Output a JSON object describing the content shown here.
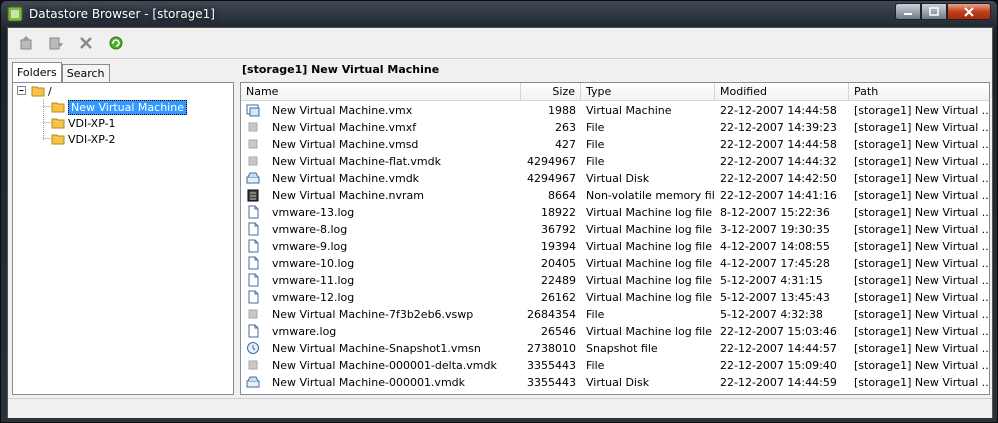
{
  "window": {
    "title": "Datastore Browser - [storage1]"
  },
  "toolbar": {
    "buttons": [
      {
        "icon": "upload-icon"
      },
      {
        "icon": "download-icon"
      },
      {
        "icon": "delete-icon"
      },
      {
        "icon": "refresh-icon"
      }
    ]
  },
  "left": {
    "tabs": [
      {
        "label": "Folders"
      },
      {
        "label": "Search"
      }
    ],
    "tree": {
      "root": "/",
      "children": [
        {
          "label": "New Virtual Machine",
          "selected": true
        },
        {
          "label": "VDI-XP-1",
          "selected": false
        },
        {
          "label": "VDI-XP-2",
          "selected": false
        }
      ]
    }
  },
  "right": {
    "title": "[storage1] New Virtual Machine",
    "columns": [
      {
        "label": "Name"
      },
      {
        "label": "Size"
      },
      {
        "label": "Type"
      },
      {
        "label": "Modified"
      },
      {
        "label": "Path"
      }
    ],
    "rows": [
      {
        "icon": "vm-icon",
        "name": "New Virtual Machine.vmx",
        "size": "1988",
        "type": "Virtual Machine",
        "modified": "22-12-2007 14:44:58",
        "path": "[storage1] New Virtual ..."
      },
      {
        "icon": "file-icon",
        "name": "New Virtual Machine.vmxf",
        "size": "263",
        "type": "File",
        "modified": "22-12-2007 14:39:23",
        "path": "[storage1] New Virtual ..."
      },
      {
        "icon": "file-icon",
        "name": "New Virtual Machine.vmsd",
        "size": "427",
        "type": "File",
        "modified": "22-12-2007 14:44:58",
        "path": "[storage1] New Virtual ..."
      },
      {
        "icon": "file-icon",
        "name": "New Virtual Machine-flat.vmdk",
        "size": "4294967",
        "type": "File",
        "modified": "22-12-2007 14:44:32",
        "path": "[storage1] New Virtual ..."
      },
      {
        "icon": "disk-icon",
        "name": "New Virtual Machine.vmdk",
        "size": "4294967",
        "type": "Virtual Disk",
        "modified": "22-12-2007 14:42:50",
        "path": "[storage1] New Virtual ..."
      },
      {
        "icon": "nvram-icon",
        "name": "New Virtual Machine.nvram",
        "size": "8664",
        "type": "Non-volatile memory file",
        "modified": "22-12-2007 14:41:16",
        "path": "[storage1] New Virtual ..."
      },
      {
        "icon": "log-icon",
        "name": "vmware-13.log",
        "size": "18922",
        "type": "Virtual Machine log file",
        "modified": "8-12-2007 15:22:36",
        "path": "[storage1] New Virtual ..."
      },
      {
        "icon": "log-icon",
        "name": "vmware-8.log",
        "size": "36792",
        "type": "Virtual Machine log file",
        "modified": "3-12-2007 19:30:35",
        "path": "[storage1] New Virtual ..."
      },
      {
        "icon": "log-icon",
        "name": "vmware-9.log",
        "size": "19394",
        "type": "Virtual Machine log file",
        "modified": "4-12-2007 14:08:55",
        "path": "[storage1] New Virtual ..."
      },
      {
        "icon": "log-icon",
        "name": "vmware-10.log",
        "size": "20405",
        "type": "Virtual Machine log file",
        "modified": "4-12-2007 17:45:28",
        "path": "[storage1] New Virtual ..."
      },
      {
        "icon": "log-icon",
        "name": "vmware-11.log",
        "size": "22489",
        "type": "Virtual Machine log file",
        "modified": "5-12-2007 4:31:15",
        "path": "[storage1] New Virtual ..."
      },
      {
        "icon": "log-icon",
        "name": "vmware-12.log",
        "size": "26162",
        "type": "Virtual Machine log file",
        "modified": "5-12-2007 13:45:43",
        "path": "[storage1] New Virtual ..."
      },
      {
        "icon": "file-icon",
        "name": "New Virtual Machine-7f3b2eb6.vswp",
        "size": "2684354",
        "type": "File",
        "modified": "5-12-2007 4:32:38",
        "path": "[storage1] New Virtual ..."
      },
      {
        "icon": "log-icon",
        "name": "vmware.log",
        "size": "26546",
        "type": "Virtual Machine log file",
        "modified": "22-12-2007 15:03:46",
        "path": "[storage1] New Virtual ..."
      },
      {
        "icon": "snapshot-icon",
        "name": "New Virtual Machine-Snapshot1.vmsn",
        "size": "2738010",
        "type": "Snapshot file",
        "modified": "22-12-2007 14:44:57",
        "path": "[storage1] New Virtual ..."
      },
      {
        "icon": "file-icon",
        "name": "New Virtual Machine-000001-delta.vmdk",
        "size": "3355443",
        "type": "File",
        "modified": "22-12-2007 15:09:40",
        "path": "[storage1] New Virtual ..."
      },
      {
        "icon": "disk-icon",
        "name": "New Virtual Machine-000001.vmdk",
        "size": "3355443",
        "type": "Virtual Disk",
        "modified": "22-12-2007 14:44:59",
        "path": "[storage1] New Virtual ..."
      }
    ]
  }
}
